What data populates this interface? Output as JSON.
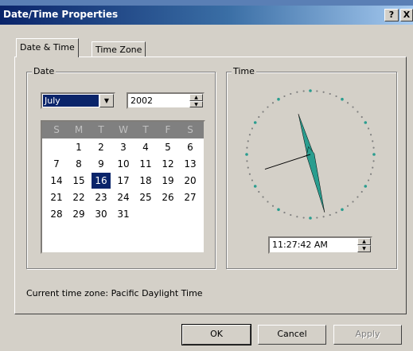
{
  "window": {
    "title": "Date/Time Properties",
    "help_label": "?",
    "close_label": "X"
  },
  "tabs": [
    {
      "label": "Date & Time",
      "active": true
    },
    {
      "label": "Time Zone",
      "active": false
    }
  ],
  "date_group": {
    "label": "Date",
    "month": "July",
    "year": "2002",
    "weekdays": [
      "S",
      "M",
      "T",
      "W",
      "T",
      "F",
      "S"
    ],
    "weeks": [
      [
        "",
        "1",
        "2",
        "3",
        "4",
        "5",
        "6"
      ],
      [
        "7",
        "8",
        "9",
        "10",
        "11",
        "12",
        "13"
      ],
      [
        "14",
        "15",
        "16",
        "17",
        "18",
        "19",
        "20"
      ],
      [
        "21",
        "22",
        "23",
        "24",
        "25",
        "26",
        "27"
      ],
      [
        "28",
        "29",
        "30",
        "31",
        "",
        "",
        ""
      ]
    ],
    "selected_day": "16"
  },
  "time_group": {
    "label": "Time",
    "time_value": "11:27:42 AM",
    "clock": {
      "hour": 11,
      "minute": 27,
      "second": 42
    }
  },
  "timezone_text": "Current time zone:  Pacific Daylight Time",
  "buttons": {
    "ok": "OK",
    "cancel": "Cancel",
    "apply": "Apply"
  },
  "colors": {
    "title_start": "#0a246a",
    "title_end": "#a6caf0",
    "hand_fill": "#2a9d8f",
    "selection": "#0a246a"
  }
}
